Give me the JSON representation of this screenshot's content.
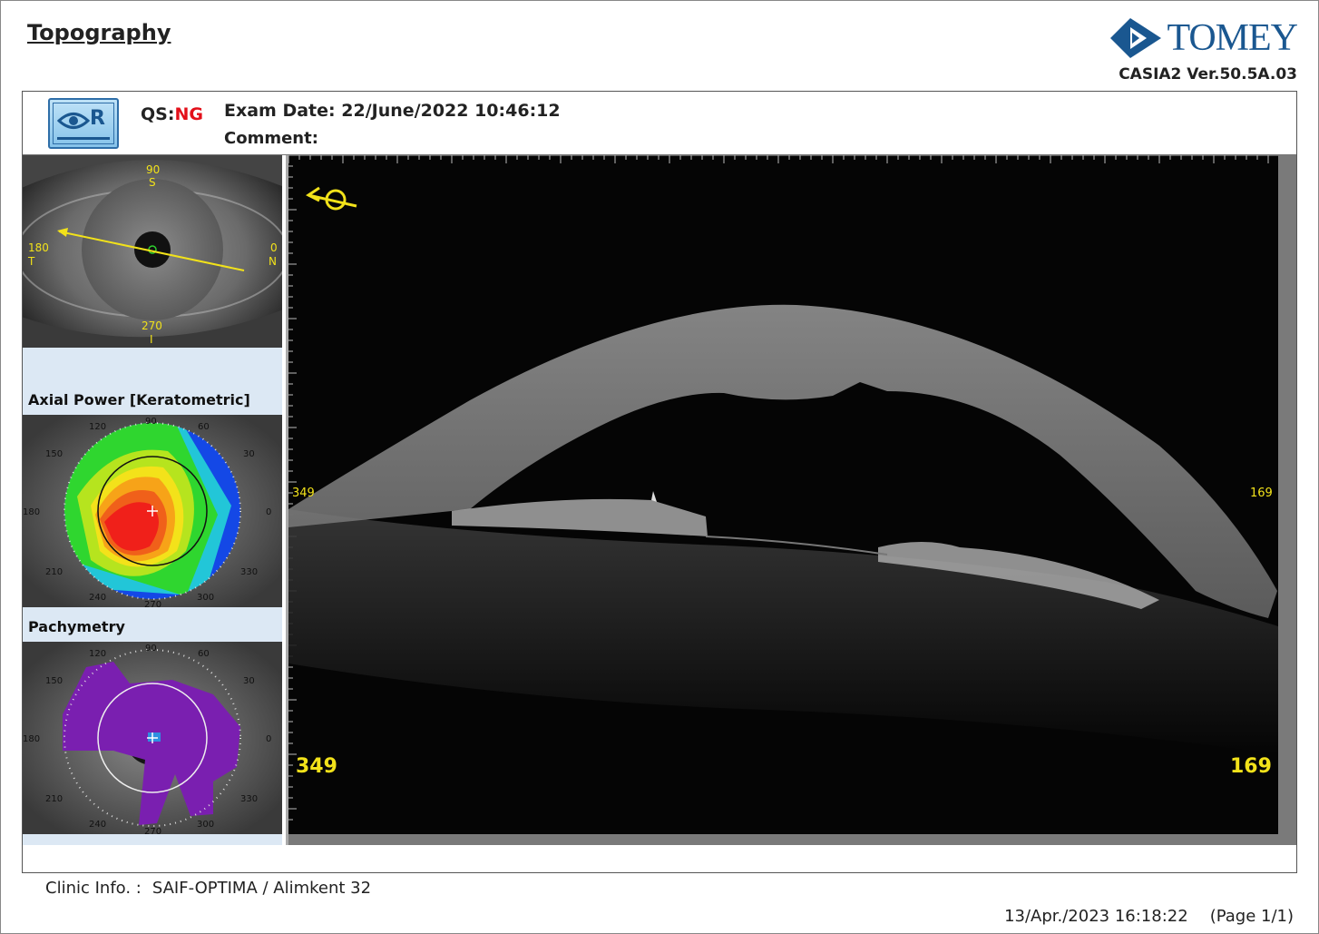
{
  "header": {
    "title": "Topography",
    "brand": "TOMEY",
    "version": "CASIA2 Ver.50.5A.03"
  },
  "exam": {
    "eye_label": "R",
    "qs_label": "QS:",
    "qs_value": "NG",
    "exam_date_label": "Exam Date:",
    "exam_date": "22/June/2022 10:46:12",
    "comment_label": "Comment:",
    "comment": ""
  },
  "eye_photo": {
    "top": [
      "90",
      "S"
    ],
    "left": [
      "180",
      "T"
    ],
    "right": [
      "0",
      "N"
    ],
    "bottom": [
      "270",
      "I"
    ]
  },
  "axial_map": {
    "label": "Axial Power [Keratometric]",
    "angles": [
      "120",
      "90",
      "60",
      "150",
      "30",
      "180",
      "0",
      "210",
      "330",
      "240",
      "270",
      "300"
    ]
  },
  "pachymetry_map": {
    "label": "Pachymetry",
    "angles": [
      "120",
      "90",
      "60",
      "150",
      "30",
      "180",
      "0",
      "210",
      "330",
      "240",
      "270",
      "300"
    ]
  },
  "scan": {
    "left_small": "349",
    "right_small": "169",
    "left_big": "349",
    "right_big": "169"
  },
  "footer": {
    "clinic_label": "Clinic Info. :",
    "clinic_value": "SAIF-OPTIMA / Alimkent 32",
    "print_date": "13/Apr./2023 16:18:22",
    "page": "(Page 1/1)"
  },
  "colors": {
    "brand": "#1a5790",
    "qs_ng": "#e3101a",
    "annotation_yellow": "#f2e21a",
    "pachy_purple": "#7a1fb0"
  }
}
